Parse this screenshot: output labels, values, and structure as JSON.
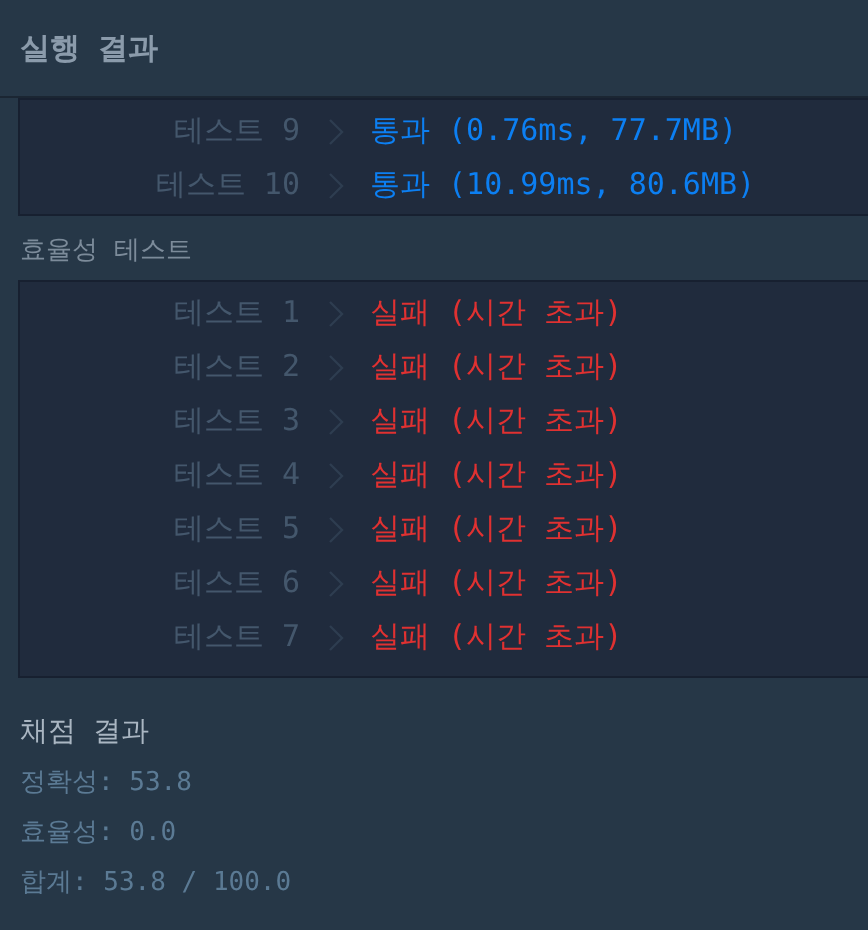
{
  "header": {
    "title": "실행 결과"
  },
  "accuracy_tests": [
    {
      "label": "테스트 9",
      "kind": "pass",
      "result": "통과 (0.76ms, 77.7MB)"
    },
    {
      "label": "테스트 10",
      "kind": "pass",
      "result": "통과 (10.99ms, 80.6MB)"
    }
  ],
  "efficiency_section": {
    "title": "효율성  테스트",
    "tests": [
      {
        "label": "테스트 1",
        "kind": "fail",
        "result": "실패 (시간 초과)"
      },
      {
        "label": "테스트 2",
        "kind": "fail",
        "result": "실패 (시간 초과)"
      },
      {
        "label": "테스트 3",
        "kind": "fail",
        "result": "실패 (시간 초과)"
      },
      {
        "label": "테스트 4",
        "kind": "fail",
        "result": "실패 (시간 초과)"
      },
      {
        "label": "테스트 5",
        "kind": "fail",
        "result": "실패 (시간 초과)"
      },
      {
        "label": "테스트 6",
        "kind": "fail",
        "result": "실패 (시간 초과)"
      },
      {
        "label": "테스트 7",
        "kind": "fail",
        "result": "실패 (시간 초과)"
      }
    ]
  },
  "grading": {
    "title": "채점 결과",
    "lines": [
      "정확성: 53.8",
      "효율성: 0.0",
      "합계: 53.8 / 100.0"
    ]
  }
}
